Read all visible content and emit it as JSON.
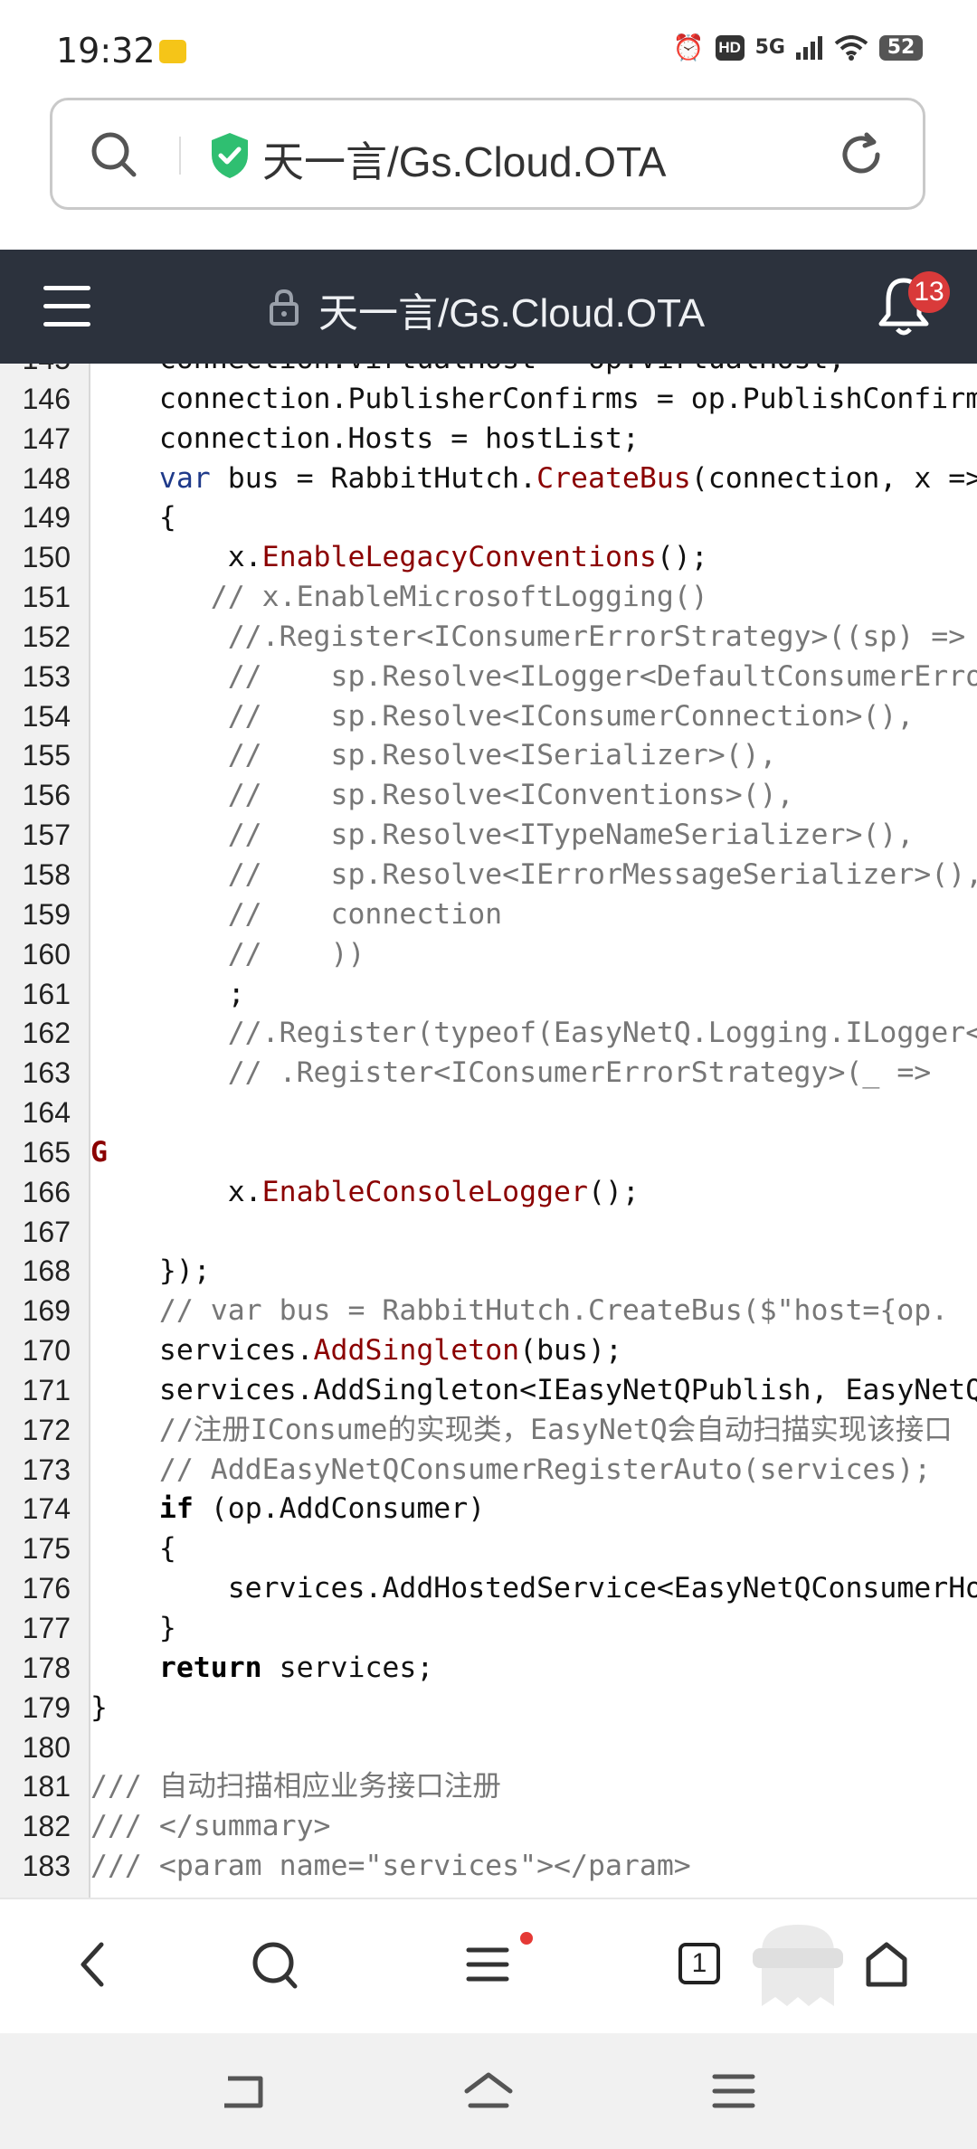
{
  "status_bar": {
    "time": "19:32",
    "network": "5G",
    "hd": "HD",
    "battery": "52"
  },
  "address_bar": {
    "url": "天一言/Gs.Cloud.OTA"
  },
  "header": {
    "title": "天一言/Gs.Cloud.OTA",
    "notifications": "13"
  },
  "code_lines": [
    {
      "n": "145",
      "t": "    connection.VirtualHost = op.VirtualHost;"
    },
    {
      "n": "146",
      "t": "    connection.PublisherConfirms = op.PublishConfirms;"
    },
    {
      "n": "147",
      "t": "    connection.Hosts = hostList;"
    },
    {
      "n": "148",
      "t": "    var bus = RabbitHutch.CreateBus(connection, x =>"
    },
    {
      "n": "149",
      "t": "    {"
    },
    {
      "n": "150",
      "t": "        x.EnableLegacyConventions();"
    },
    {
      "n": "151",
      "t": "       // x.EnableMicrosoftLogging()"
    },
    {
      "n": "152",
      "t": "        //.Register<IConsumerErrorStrategy>((sp) =>"
    },
    {
      "n": "153",
      "t": "        //    sp.Resolve<ILogger<DefaultConsumerErrorStrategy>>(),"
    },
    {
      "n": "154",
      "t": "        //    sp.Resolve<IConsumerConnection>(),"
    },
    {
      "n": "155",
      "t": "        //    sp.Resolve<ISerializer>(),"
    },
    {
      "n": "156",
      "t": "        //    sp.Resolve<IConventions>(),"
    },
    {
      "n": "157",
      "t": "        //    sp.Resolve<ITypeNameSerializer>(),"
    },
    {
      "n": "158",
      "t": "        //    sp.Resolve<IErrorMessageSerializer>(),"
    },
    {
      "n": "159",
      "t": "        //    connection"
    },
    {
      "n": "160",
      "t": "        //    ))"
    },
    {
      "n": "161",
      "t": "        ;"
    },
    {
      "n": "162",
      "t": "        //.Register(typeof(EasyNetQ.Logging.ILogger<>)"
    },
    {
      "n": "163",
      "t": "        // .Register<IConsumerErrorStrategy>(_ =>"
    },
    {
      "n": "164",
      "t": ""
    },
    {
      "n": "165",
      "t": "G"
    },
    {
      "n": "166",
      "t": "        x.EnableConsoleLogger();"
    },
    {
      "n": "167",
      "t": ""
    },
    {
      "n": "168",
      "t": "    });"
    },
    {
      "n": "169",
      "t": "    // var bus = RabbitHutch.CreateBus($\"host={op."
    },
    {
      "n": "170",
      "t": "    services.AddSingleton(bus);"
    },
    {
      "n": "171",
      "t": "    services.AddSingleton<IEasyNetQPublish, EasyNetQPublish>();"
    },
    {
      "n": "172",
      "t": "    //注册IConsume的实现类，EasyNetQ会自动扫描实现该接口"
    },
    {
      "n": "173",
      "t": "    // AddEasyNetQConsumerRegisterAuto(services);"
    },
    {
      "n": "174",
      "t": "    if (op.AddConsumer)"
    },
    {
      "n": "175",
      "t": "    {"
    },
    {
      "n": "176",
      "t": "        services.AddHostedService<EasyNetQConsumerHostedService>();"
    },
    {
      "n": "177",
      "t": "    }"
    },
    {
      "n": "178",
      "t": "    return services;"
    },
    {
      "n": "179",
      "t": "}"
    },
    {
      "n": "180",
      "t": ""
    },
    {
      "n": "181",
      "t": "/// 自动扫描相应业务接口注册"
    },
    {
      "n": "182",
      "t": "/// </summary>"
    },
    {
      "n": "183",
      "t": "/// <param name=\"services\"></param>"
    }
  ],
  "bottom_nav": {
    "tabs_count": "1"
  },
  "icons": [
    "search-icon",
    "shield-check-icon",
    "reload-icon",
    "menu-icon",
    "lock-icon",
    "bell-icon",
    "back-icon",
    "tabs-icon",
    "home-icon",
    "ghost-icon"
  ]
}
